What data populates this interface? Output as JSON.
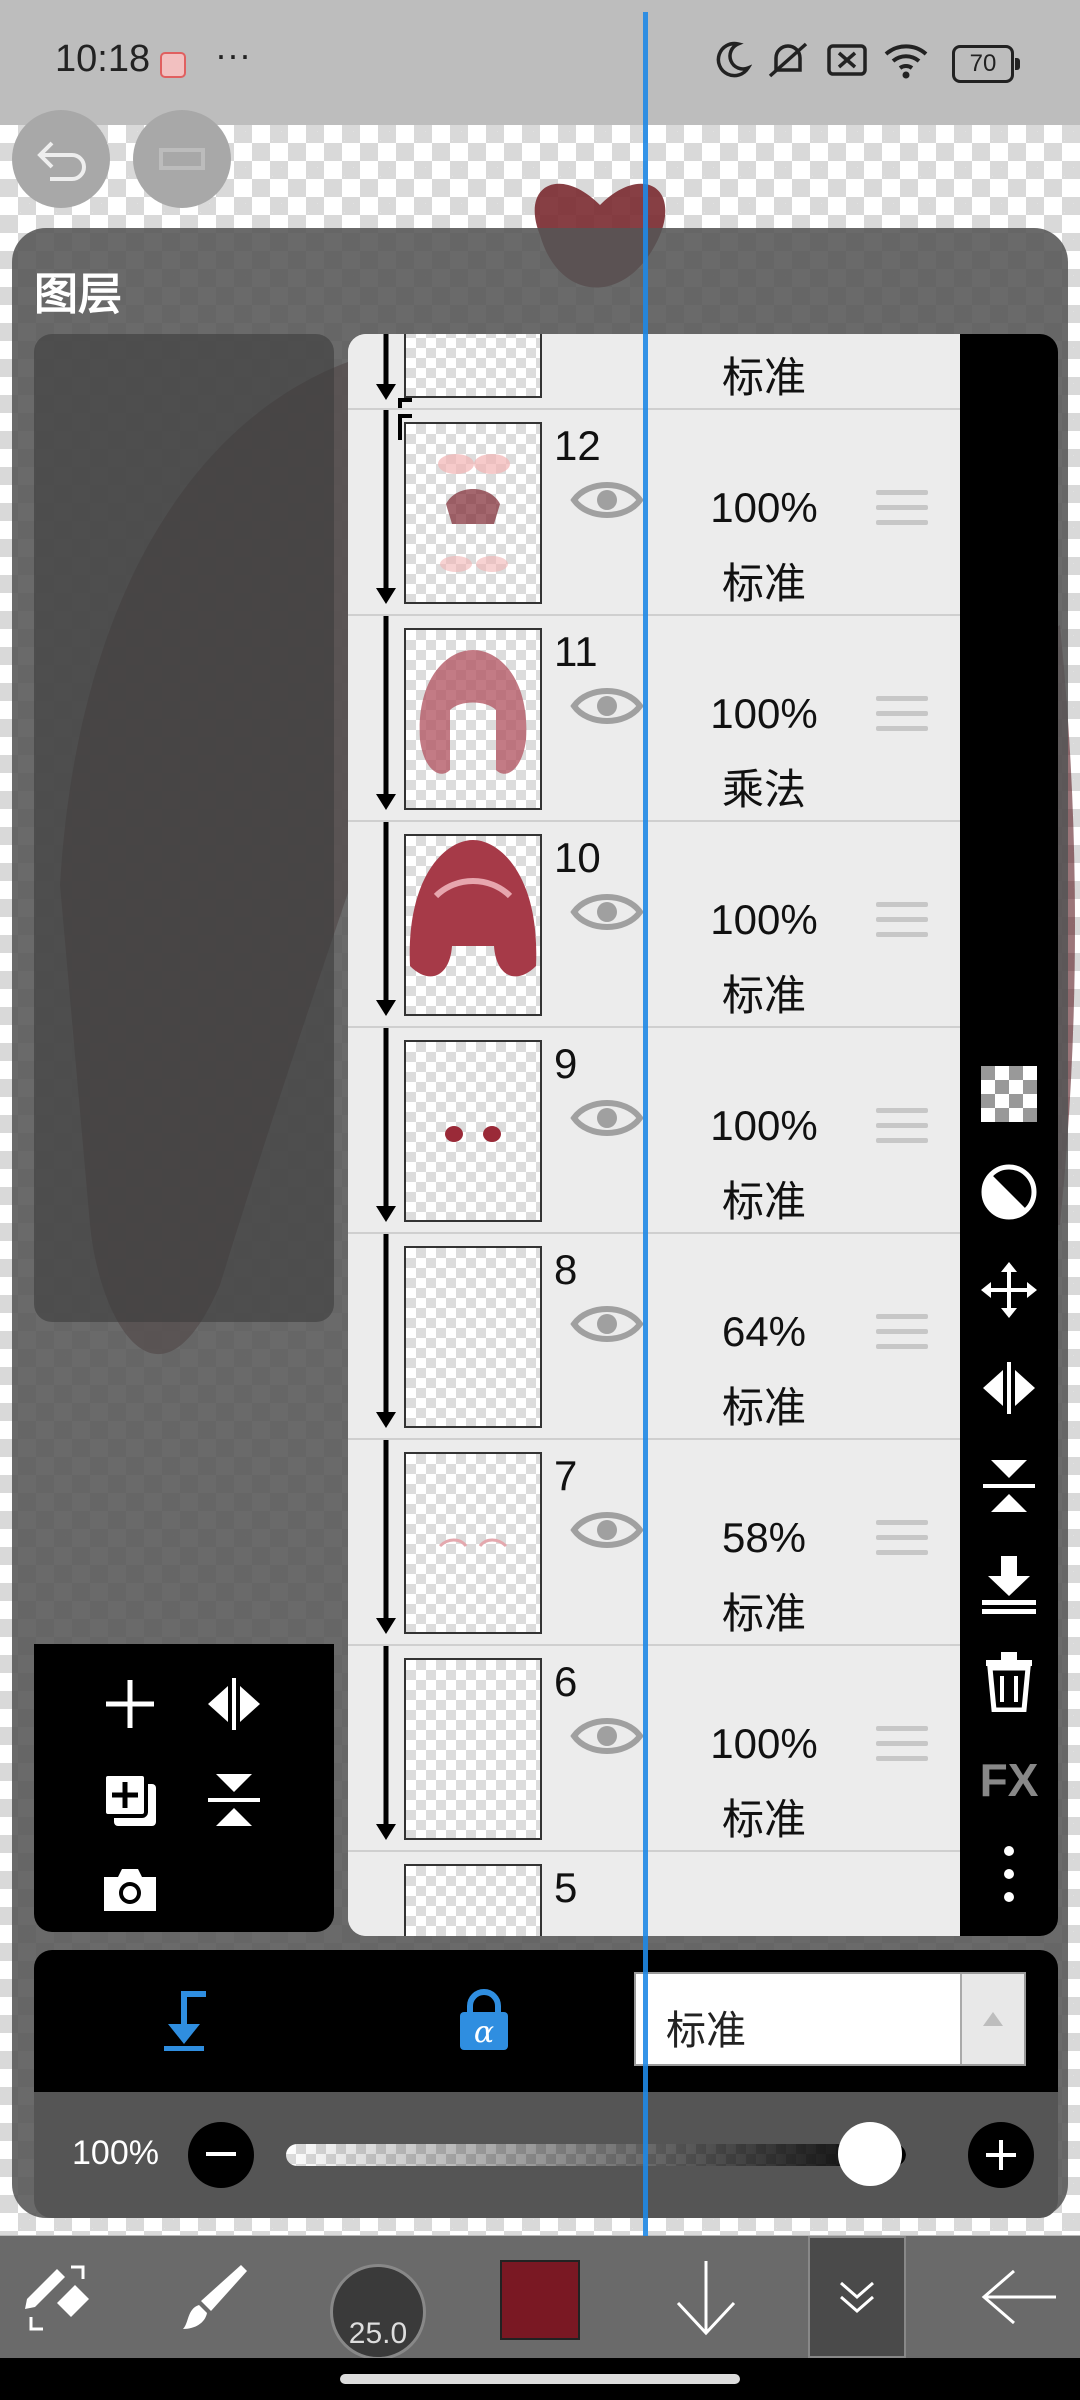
{
  "status_bar": {
    "time": "10:18",
    "dots": "···",
    "battery": "70"
  },
  "panel": {
    "title": "图层"
  },
  "layers": [
    {
      "num": "",
      "opacity": "",
      "blend": "标准"
    },
    {
      "num": "12",
      "opacity": "100%",
      "blend": "标准"
    },
    {
      "num": "11",
      "opacity": "100%",
      "blend": "乘法"
    },
    {
      "num": "10",
      "opacity": "100%",
      "blend": "标准"
    },
    {
      "num": "9",
      "opacity": "100%",
      "blend": "标准"
    },
    {
      "num": "8",
      "opacity": "64%",
      "blend": "标准"
    },
    {
      "num": "7",
      "opacity": "58%",
      "blend": "标准"
    },
    {
      "num": "6",
      "opacity": "100%",
      "blend": "标准"
    },
    {
      "num": "5",
      "opacity": "",
      "blend": ""
    }
  ],
  "right_tools": {
    "fx_label": "FX"
  },
  "blend_mode": {
    "value": "标准"
  },
  "layer_opacity": {
    "label": "100%",
    "value": 1.0
  },
  "brush": {
    "size": "25.0"
  },
  "colors": {
    "primary": "#7a1823",
    "accent": "#1f88e5"
  }
}
